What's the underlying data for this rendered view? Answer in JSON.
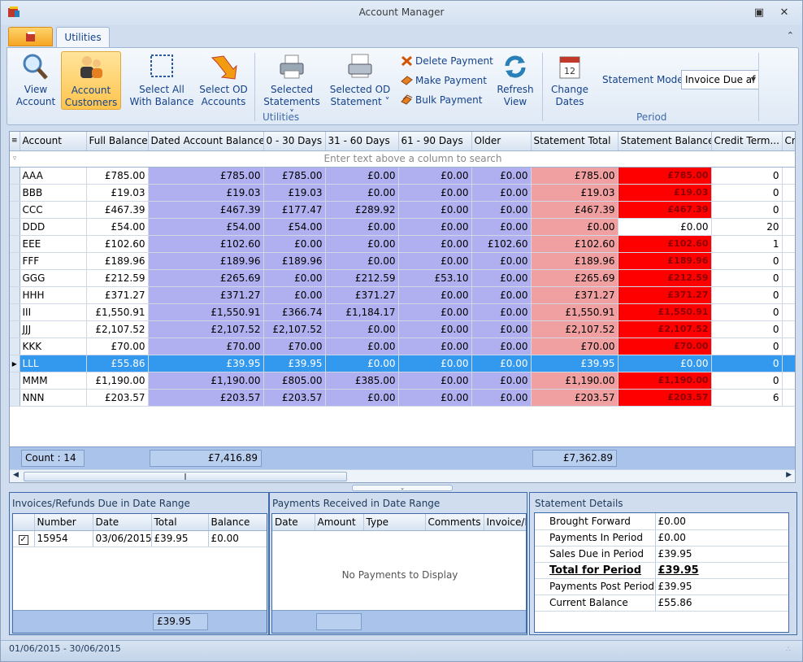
{
  "window": {
    "title": "Account Manager"
  },
  "tabs": {
    "utilities": "Utilities"
  },
  "ribbon": {
    "view_account": [
      "View",
      "Account"
    ],
    "account_customers": [
      "Account",
      "Customers"
    ],
    "select_all": [
      "Select All",
      "With Balance"
    ],
    "select_od": [
      "Select OD",
      "Accounts"
    ],
    "selected_statements": [
      "Selected",
      "Statements ˅"
    ],
    "selected_od_statement": [
      "Selected OD",
      "Statement ˅"
    ],
    "delete_payment": "Delete Payment",
    "make_payment": "Make Payment",
    "bulk_payment": "Bulk Payment",
    "refresh_view": [
      "Refresh",
      "View"
    ],
    "change_dates": [
      "Change",
      "Dates"
    ],
    "statement_mode_label": "Statement Mode",
    "statement_mode_value": "Invoice Due af",
    "group_utilities": "Utilities",
    "group_period": "Period"
  },
  "grid": {
    "columns": [
      "Account",
      "Full Balance",
      "Dated Account Balance",
      "0 - 30 Days",
      "31 - 60 Days",
      "61 - 90 Days",
      "Older",
      "Statement Total",
      "Statement Balance",
      "Credit Term...",
      "Cr"
    ],
    "search_placeholder": "Enter text above a column to search",
    "rows": [
      [
        "AAA",
        "£785.00",
        "£785.00",
        "£785.00",
        "£0.00",
        "£0.00",
        "£0.00",
        "£785.00",
        "£785.00",
        "0"
      ],
      [
        "BBB",
        "£19.03",
        "£19.03",
        "£19.03",
        "£0.00",
        "£0.00",
        "£0.00",
        "£19.03",
        "£19.03",
        "0"
      ],
      [
        "CCC",
        "£467.39",
        "£467.39",
        "£177.47",
        "£289.92",
        "£0.00",
        "£0.00",
        "£467.39",
        "£467.39",
        "0"
      ],
      [
        "DDD",
        "£54.00",
        "£54.00",
        "£54.00",
        "£0.00",
        "£0.00",
        "£0.00",
        "£0.00",
        "£0.00",
        "20"
      ],
      [
        "EEE",
        "£102.60",
        "£102.60",
        "£0.00",
        "£0.00",
        "£0.00",
        "£102.60",
        "£102.60",
        "£102.60",
        "1"
      ],
      [
        "FFF",
        "£189.96",
        "£189.96",
        "£189.96",
        "£0.00",
        "£0.00",
        "£0.00",
        "£189.96",
        "£189.96",
        "0"
      ],
      [
        "GGG",
        "£212.59",
        "£265.69",
        "£0.00",
        "£212.59",
        "£53.10",
        "£0.00",
        "£265.69",
        "£212.59",
        "0"
      ],
      [
        "HHH",
        "£371.27",
        "£371.27",
        "£0.00",
        "£371.27",
        "£0.00",
        "£0.00",
        "£371.27",
        "£371.27",
        "0"
      ],
      [
        "III",
        "£1,550.91",
        "£1,550.91",
        "£366.74",
        "£1,184.17",
        "£0.00",
        "£0.00",
        "£1,550.91",
        "£1,550.91",
        "0"
      ],
      [
        "JJJ",
        "£2,107.52",
        "£2,107.52",
        "£2,107.52",
        "£0.00",
        "£0.00",
        "£0.00",
        "£2,107.52",
        "£2,107.52",
        "0"
      ],
      [
        "KKK",
        "£70.00",
        "£70.00",
        "£70.00",
        "£0.00",
        "£0.00",
        "£0.00",
        "£70.00",
        "£70.00",
        "0"
      ],
      [
        "LLL",
        "£55.86",
        "£39.95",
        "£39.95",
        "£0.00",
        "£0.00",
        "£0.00",
        "£39.95",
        "£0.00",
        "0"
      ],
      [
        "MMM",
        "£1,190.00",
        "£1,190.00",
        "£805.00",
        "£385.00",
        "£0.00",
        "£0.00",
        "£1,190.00",
        "£1,190.00",
        "0"
      ],
      [
        "NNN",
        "£203.57",
        "£203.57",
        "£203.57",
        "£0.00",
        "£0.00",
        "£0.00",
        "£203.57",
        "£203.57",
        "6"
      ]
    ],
    "selected_row": 11,
    "white_balance_rows": [
      3
    ],
    "footer": {
      "count": "Count : 14",
      "dated_total": "£7,416.89",
      "statement_total": "£7,362.89"
    }
  },
  "invoices": {
    "title": "Invoices/Refunds Due in Date Range",
    "columns": [
      "Number",
      "Date",
      "Total",
      "Balance"
    ],
    "rows": [
      [
        "15954",
        "03/06/2015",
        "£39.95",
        "£0.00"
      ]
    ],
    "checked_mark": "✓",
    "footer_total": "£39.95"
  },
  "payments": {
    "title": "Payments Received in Date Range",
    "columns": [
      "Date",
      "Amount",
      "Type",
      "Comments",
      "Invoice/I"
    ],
    "empty": "No Payments to Display"
  },
  "statement_details": {
    "title": "Statement Details",
    "rows": [
      [
        "Brought Forward",
        "£0.00"
      ],
      [
        "Payments In Period",
        "£0.00"
      ],
      [
        "Sales Due in Period",
        "£39.95"
      ],
      [
        "Total for Period",
        "£39.95"
      ],
      [
        "Payments Post Period",
        "£39.95"
      ],
      [
        "Current Balance",
        "£55.86"
      ]
    ],
    "bold_row": 3
  },
  "status": {
    "period": "01/06/2015 - 30/06/2015"
  },
  "colors": {
    "lavender": "#b0b0f0",
    "pink": "#f0a0a0",
    "red": "#ff0000",
    "selected": "#3399ee"
  }
}
